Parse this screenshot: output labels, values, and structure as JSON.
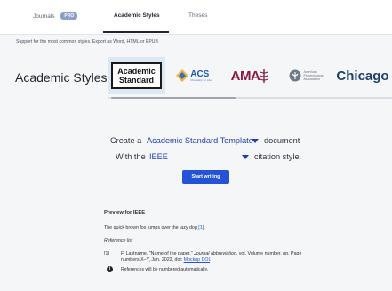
{
  "tabs": {
    "journals": "Journals",
    "journals_badge": "PRO",
    "academic_styles": "Academic Styles",
    "theses": "Theses"
  },
  "subtitle": "Support for the most common styles. Export as Word, HTML or EPUB",
  "section_title": "Academic Styles",
  "logos": {
    "academic_standard_line1": "Academic",
    "academic_standard_line2": "Standard",
    "acs": "ACS",
    "acs_tagline": "Chemistry for Life",
    "ama": "AMA",
    "apa_line1": "American",
    "apa_line2": "Psychological",
    "apa_line3": "Association",
    "chicago": "Chicago"
  },
  "builder": {
    "create_a": "Create a",
    "template_value": "Academic Standard Template",
    "document": "document",
    "with_the": "With the",
    "citation_value": "IEEE",
    "citation_style": "citation style.",
    "start_button": "Start writing"
  },
  "preview": {
    "title": "Preview for IEEE",
    "text_before": "The quick brown fox jumps over the lazy dog ",
    "text_ref": "[1]",
    "text_after": ".",
    "reference_list": "Reference list",
    "ref_number": "[1]",
    "ref_part1": "F. Lastname, \"Name of the paper,\" ",
    "ref_journal": "Journal abbreviation",
    "ref_part2": ", vol. Volume number, pp. Page numbers X–Y, Jan. 2022, doi: ",
    "ref_doi": "Mockup DOI",
    "ref_part3": ".",
    "note": "References will be numbered automatically."
  },
  "colors": {
    "accent": "#2553d8",
    "link": "#1d3fb0",
    "selected_logo_bg": "#dde8f5",
    "ama": "#8a1a44",
    "chicago": "#1f3f6e"
  }
}
